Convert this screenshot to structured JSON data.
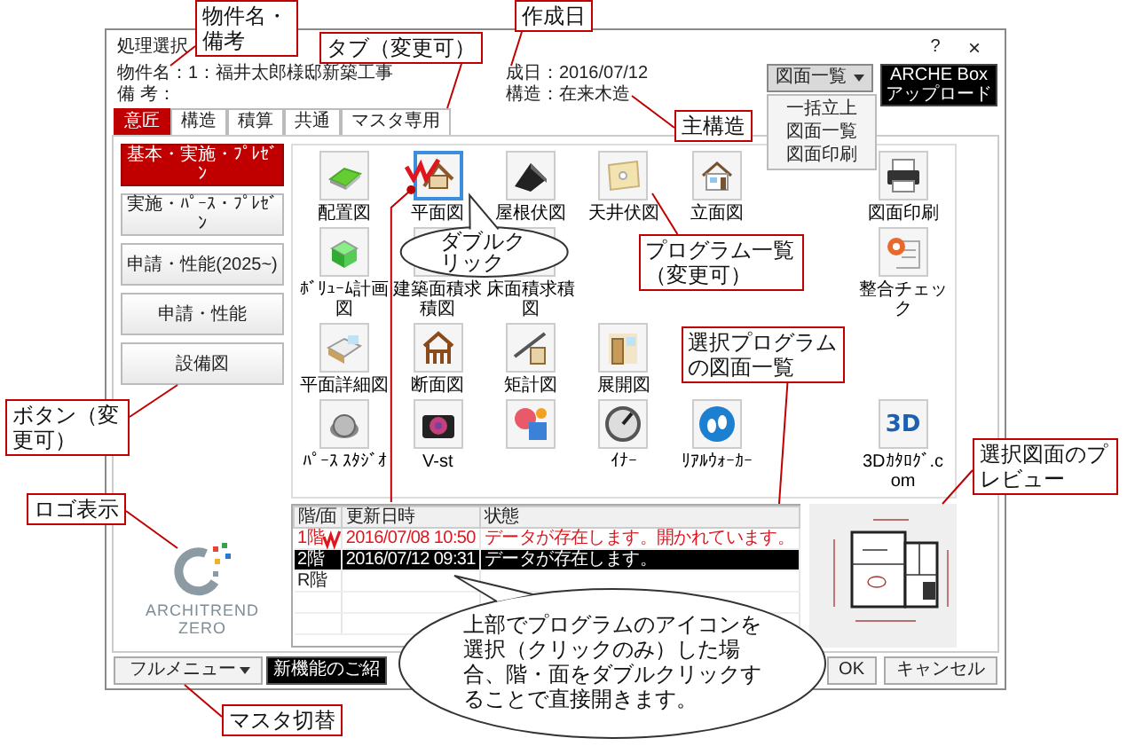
{
  "window": {
    "title": "処理選択",
    "help": "?",
    "close": "×"
  },
  "info": {
    "property": "物件名：1：福井太郎様邸新築工事",
    "remarks": "備 考：",
    "created": "成日：2016/07/12",
    "structure": "構造：在来木造"
  },
  "list_button": {
    "label": "図面一覧",
    "expanded": true
  },
  "menu": [
    "一括立上",
    "図面一覧",
    "図面印刷"
  ],
  "upload_button": "ARCHE Boxアップロード",
  "tabs": [
    {
      "label": "意匠",
      "selected": true
    },
    {
      "label": "構造",
      "selected": false
    },
    {
      "label": "積算",
      "selected": false
    },
    {
      "label": "共通",
      "selected": false
    },
    {
      "label": "マスタ専用",
      "selected": false
    }
  ],
  "categories": [
    {
      "label": "基本・実施・ﾌﾟﾚｾﾞﾝ",
      "selected": true
    },
    {
      "label": "実施・ﾊﾟｰｽ・ﾌﾟﾚｾﾞﾝ",
      "selected": false
    },
    {
      "label": "申請・性能(2025~)",
      "selected": false
    },
    {
      "label": "申請・性能",
      "selected": false
    },
    {
      "label": "設備図",
      "selected": false
    }
  ],
  "program_rows": [
    [
      {
        "label": "配置図",
        "selected": false
      },
      {
        "label": "平面図",
        "selected": true
      },
      {
        "label": "屋根伏図",
        "selected": false
      },
      {
        "label": "天井伏図",
        "selected": false
      },
      {
        "label": "立面図",
        "selected": false
      },
      null,
      {
        "label": "図面印刷",
        "selected": false
      }
    ],
    [
      {
        "label": "ﾎﾞﾘｭｰﾑ計画図",
        "selected": false
      },
      {
        "label": "建築面積求積図",
        "selected": false
      },
      {
        "label": "床面積求積図",
        "selected": false
      },
      null,
      null,
      null,
      {
        "label": "整合チェック",
        "selected": false
      }
    ],
    [
      {
        "label": "平面詳細図",
        "selected": false
      },
      {
        "label": "断面図",
        "selected": false
      },
      {
        "label": "矩計図",
        "selected": false
      },
      {
        "label": "展開図",
        "selected": false
      }
    ],
    [
      {
        "label": "ﾊﾟｰｽ ｽﾀｼﾞｵ",
        "selected": false
      },
      {
        "label": "V-st",
        "selected": false
      },
      {
        "selected": false
      },
      {
        "label": "ｲﾅｰ",
        "selected": false
      },
      {
        "label": "ﾘｱﾙｳｫｰｶｰ",
        "selected": false
      },
      null,
      {
        "label": "3Dｶﾀﾛｸﾞ.com",
        "icon_text": "3D",
        "selected": false
      }
    ]
  ],
  "drawings_table": {
    "columns": [
      "階/面",
      "更新日時",
      "状態"
    ],
    "rows": [
      {
        "kind": "open",
        "selected": false,
        "cells": [
          "1階",
          "2016/07/08 10:50",
          "データが存在します。開かれています。"
        ]
      },
      {
        "kind": "exists",
        "selected": true,
        "cells": [
          "2階",
          "2016/07/12 09:31",
          "データが存在します。"
        ]
      },
      {
        "kind": "empty",
        "selected": false,
        "cells": [
          "R階"
        ]
      }
    ]
  },
  "logo": {
    "name": "ARCHITREND",
    "edition": "ZERO"
  },
  "footer": {
    "menu_button": "フルメニュー",
    "news_button": "新機能のご紹",
    "ok": "OK",
    "cancel": "キャンセル"
  },
  "annotations": [
    {
      "kind": "box",
      "text": "物件名・備考"
    },
    {
      "kind": "box",
      "text": "作成日"
    },
    {
      "kind": "box",
      "text": "タブ（変更可）"
    },
    {
      "kind": "box",
      "text": "主構造"
    },
    {
      "kind": "bubble",
      "text": "ダブルクリック"
    },
    {
      "kind": "box",
      "text": "プログラム一覧（変更可）"
    },
    {
      "kind": "box",
      "text": "選択プログラムの図面一覧"
    },
    {
      "kind": "box",
      "text": "ボタン（変更可）"
    },
    {
      "kind": "box",
      "text": "選択図面のプレビュー"
    },
    {
      "kind": "box",
      "text": "ロゴ表示"
    },
    {
      "kind": "bubble",
      "text": "上部でプログラムのアイコンを選択（クリックのみ）した場合、階・面をダブルクリックすることで直接開きます。"
    },
    {
      "kind": "box",
      "text": "マスタ切替"
    }
  ]
}
